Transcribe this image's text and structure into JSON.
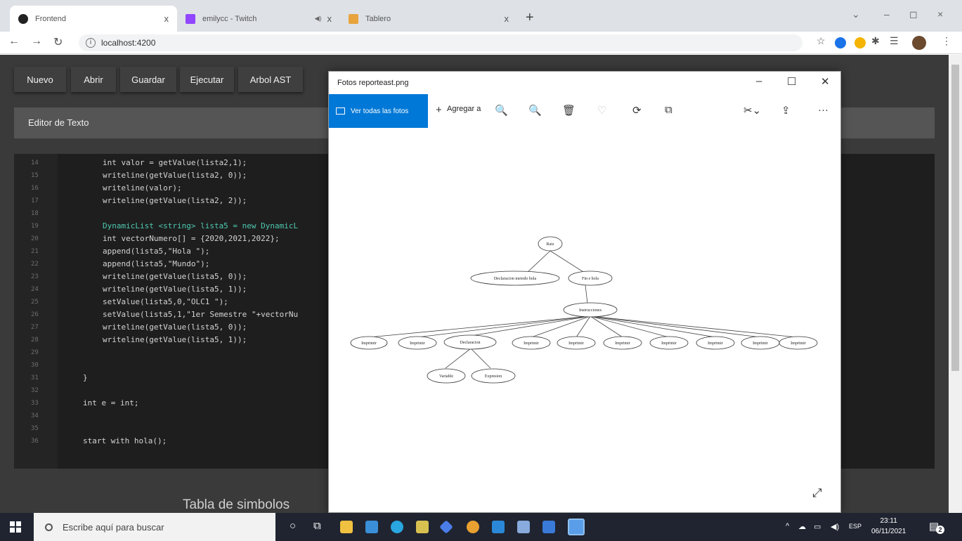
{
  "browser": {
    "tabs": [
      {
        "title": "Frontend",
        "close": "x"
      },
      {
        "title": "emilycc - Twitch",
        "close": "x"
      },
      {
        "title": "Tablero",
        "close": "x"
      }
    ],
    "new_tab": "+",
    "url": "localhost:4200",
    "controls": {
      "minimize": "–",
      "restore": "◻",
      "close": "×"
    }
  },
  "app": {
    "menu": [
      "Nuevo",
      "Abrir",
      "Guardar",
      "Ejecutar",
      "Arbol AST"
    ],
    "editor_title": "Editor de Texto",
    "line_numbers": [
      "14",
      "15",
      "16",
      "17",
      "18",
      "19",
      "20",
      "21",
      "22",
      "23",
      "24",
      "25",
      "26",
      "27",
      "28",
      "29",
      "30",
      "31",
      "32",
      "33",
      "34",
      "35",
      "36"
    ],
    "code_lines": [
      "int valor = getValue(lista2,1);",
      "writeline(getValue(lista2, 0));",
      "writeline(valor);",
      "writeline(getValue(lista2, 2));",
      "",
      "DynamicList <string> lista5 = new DynamicL",
      "int vectorNumero[] = {2020,2021,2022};",
      "append(lista5,\"Hola \");",
      "append(lista5,\"Mundo\");",
      "writeline(getValue(lista5, 0));",
      "writeline(getValue(lista5, 1));",
      "setValue(lista5,0,\"OLC1 \");",
      "setValue(lista5,1,\"1er Semestre \"+vectorNu",
      "writeline(getValue(lista5, 0));",
      "writeline(getValue(lista5, 1));",
      "",
      "",
      "}",
      "",
      "int e = int;",
      "",
      "",
      "start with hola();"
    ],
    "symbols_title": "Tabla de simbolos"
  },
  "photos": {
    "title": "Fotos reporteast.png",
    "all_photos": "Ver todas las fotos",
    "add_to": "Agregar a",
    "tree": {
      "root": "Raiz",
      "level1": [
        "Declaracion metodo hola",
        "Fin e hola"
      ],
      "level2": "Instrucciones",
      "level3": [
        "Imprimir",
        "Imprimir",
        "Declaracion",
        "Imprimir",
        "Imprimir",
        "Imprimir",
        "Imprimir",
        "Imprimir",
        "Imprimir",
        "Imprimir"
      ],
      "level4": [
        "Variable",
        "Expresion"
      ]
    }
  },
  "taskbar": {
    "search_placeholder": "Escribe aquí para buscar",
    "lang": "ESP",
    "time": "23:11",
    "date": "06/11/2021",
    "notifications": "2"
  }
}
